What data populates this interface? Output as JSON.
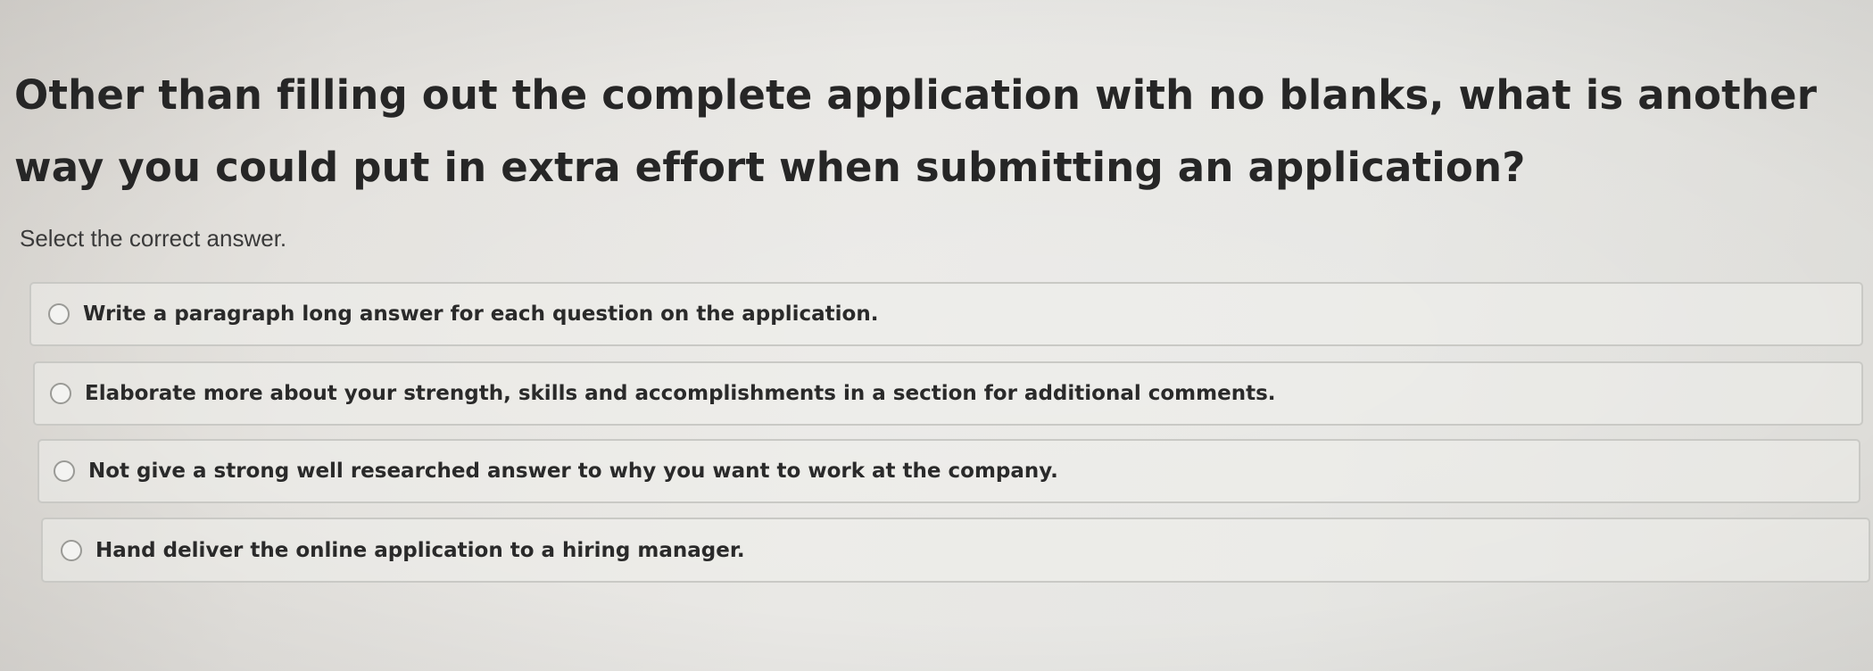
{
  "question": {
    "text": "Other than filling out the complete application with no blanks, what is another way you could put in extra effort when submitting an application?"
  },
  "instruction": "Select the correct answer.",
  "options": [
    {
      "label": "Write a paragraph long answer for each question on the application.",
      "selected": false
    },
    {
      "label": "Elaborate more about your strength, skills and accomplishments in a section for additional comments.",
      "selected": false
    },
    {
      "label": "Not give a strong well researched answer to why you want to work at the company.",
      "selected": false
    },
    {
      "label": "Hand deliver the online application to a hiring manager.",
      "selected": false
    }
  ]
}
